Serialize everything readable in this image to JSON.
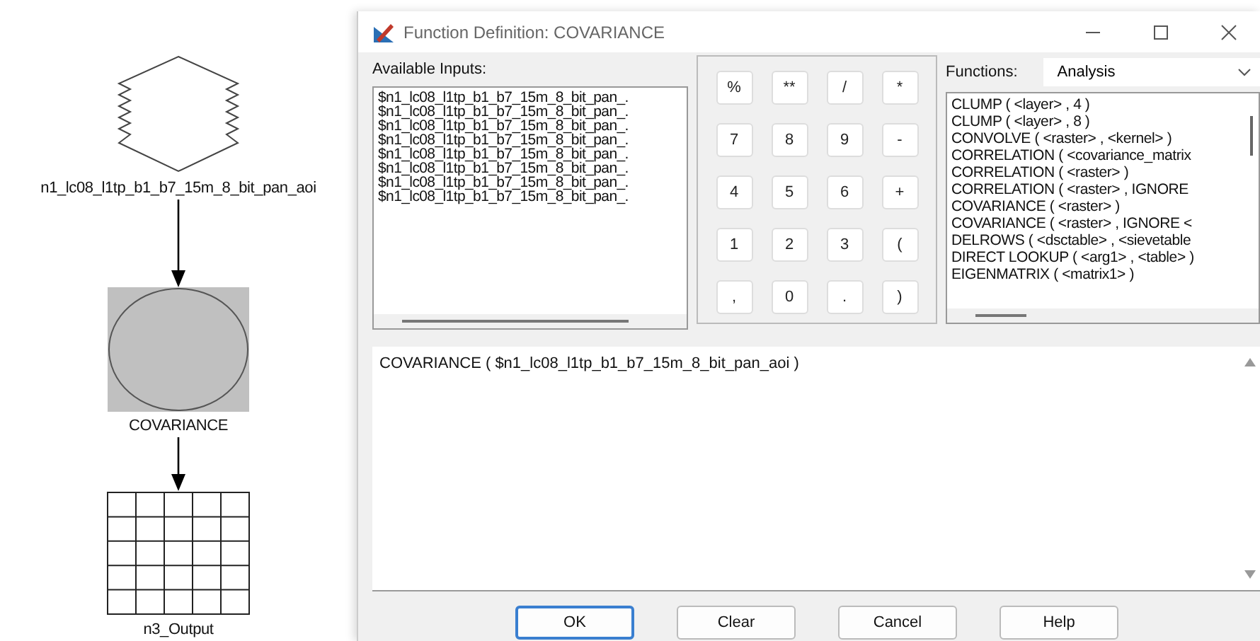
{
  "diagram": {
    "nodes": [
      {
        "kind": "raster-input",
        "label": "n1_lc08_l1tp_b1_b7_15m_8_bit_pan_aoi"
      },
      {
        "kind": "function",
        "label": "COVARIANCE"
      },
      {
        "kind": "raster-output",
        "label": "n3_Output"
      }
    ]
  },
  "window": {
    "title": "Function Definition:  COVARIANCE"
  },
  "available_inputs": {
    "label": "Available Inputs:",
    "items": [
      "$n1_lc08_l1tp_b1_b7_15m_8_bit_pan_.",
      "$n1_lc08_l1tp_b1_b7_15m_8_bit_pan_.",
      "$n1_lc08_l1tp_b1_b7_15m_8_bit_pan_.",
      "$n1_lc08_l1tp_b1_b7_15m_8_bit_pan_.",
      "$n1_lc08_l1tp_b1_b7_15m_8_bit_pan_.",
      "$n1_lc08_l1tp_b1_b7_15m_8_bit_pan_.",
      "$n1_lc08_l1tp_b1_b7_15m_8_bit_pan_.",
      "$n1_lc08_l1tp_b1_b7_15m_8_bit_pan_."
    ]
  },
  "keypad": [
    "%",
    "**",
    "/",
    "*",
    "7",
    "8",
    "9",
    "-",
    "4",
    "5",
    "6",
    "+",
    "1",
    "2",
    "3",
    "(",
    ",",
    "0",
    ".",
    ")"
  ],
  "functions": {
    "label": "Functions:",
    "category": "Analysis",
    "items": [
      "CLUMP ( <layer> , 4 )",
      "CLUMP ( <layer> , 8 )",
      "CONVOLVE ( <raster> , <kernel> )",
      "CORRELATION ( <covariance_matrix",
      "CORRELATION ( <raster> )",
      "CORRELATION ( <raster> , IGNORE",
      "COVARIANCE ( <raster> )",
      "COVARIANCE ( <raster> , IGNORE <",
      "DELROWS ( <dsctable> , <sievetable",
      "DIRECT LOOKUP ( <arg1> , <table> )",
      "EIGENMATRIX ( <matrix1> )"
    ]
  },
  "expression": "COVARIANCE ( $n1_lc08_l1tp_b1_b7_15m_8_bit_pan_aoi )",
  "buttons": [
    {
      "label": "OK",
      "default": true
    },
    {
      "label": "Clear",
      "default": false
    },
    {
      "label": "Cancel",
      "default": false
    },
    {
      "label": "Help",
      "default": false
    }
  ]
}
